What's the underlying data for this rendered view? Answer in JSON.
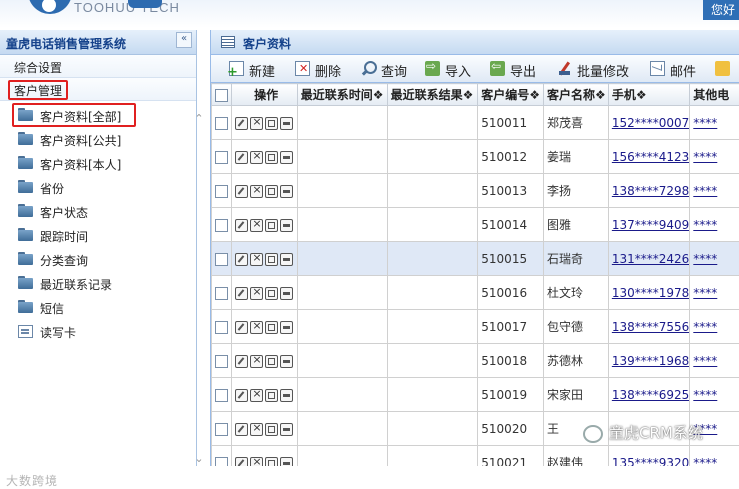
{
  "banner": {
    "brand": "TOOHUU TECH",
    "greeting": "您好"
  },
  "sidebar": {
    "title": "童虎电话销售管理系统",
    "collapse_glyph": "«",
    "sections": [
      {
        "label": "综合设置"
      },
      {
        "label": "客户管理"
      }
    ],
    "items": [
      {
        "label": "客户资料[全部]",
        "icon": "folder-icon"
      },
      {
        "label": "客户资料[公共]",
        "icon": "folder-icon"
      },
      {
        "label": "客户资料[本人]",
        "icon": "folder-icon"
      },
      {
        "label": "省份",
        "icon": "folder-icon"
      },
      {
        "label": "客户状态",
        "icon": "folder-icon"
      },
      {
        "label": "跟踪时间",
        "icon": "folder-icon"
      },
      {
        "label": "分类查询",
        "icon": "folder-icon"
      },
      {
        "label": "最近联系记录",
        "icon": "folder-icon"
      },
      {
        "label": "短信",
        "icon": "folder-icon"
      },
      {
        "label": "读写卡",
        "icon": "card-icon"
      }
    ],
    "watermark": "大数跨境"
  },
  "main": {
    "title": "客户资料",
    "toolbar": {
      "new": "新建",
      "delete": "删除",
      "search": "查询",
      "import": "导入",
      "export": "导出",
      "batch_edit": "批量修改",
      "mail": "邮件"
    },
    "columns": {
      "ops": "操作",
      "last_time": "最近联系时间❖",
      "last_result": "最近联系结果❖",
      "code": "客户编号❖",
      "name": "客户名称❖",
      "phone": "手机❖",
      "other": "其他电"
    },
    "rows": [
      {
        "code": "510011",
        "name": "郑茂喜",
        "phone": "152****0007",
        "other": "****"
      },
      {
        "code": "510012",
        "name": "姜瑞",
        "phone": "156****4123",
        "other": "****"
      },
      {
        "code": "510013",
        "name": "李扬",
        "phone": "138****7298",
        "other": "****"
      },
      {
        "code": "510014",
        "name": "图雅",
        "phone": "137****9409",
        "other": "****"
      },
      {
        "code": "510015",
        "name": "石瑞奇",
        "phone": "131****2426",
        "other": "****"
      },
      {
        "code": "510016",
        "name": "杜文玲",
        "phone": "130****1978",
        "other": "****"
      },
      {
        "code": "510017",
        "name": "包守德",
        "phone": "138****7556",
        "other": "****"
      },
      {
        "code": "510018",
        "name": "苏德林",
        "phone": "139****1968",
        "other": "****"
      },
      {
        "code": "510019",
        "name": "宋家田",
        "phone": "138****6925",
        "other": "****"
      },
      {
        "code": "510020",
        "name": "王",
        "phone": "",
        "other": "****"
      },
      {
        "code": "510021",
        "name": "赵建伟",
        "phone": "135****9320",
        "other": "****"
      }
    ],
    "watermark": "童虎CRM系统"
  },
  "colors": {
    "header_blue": "#15428b",
    "highlight_red": "#e02020",
    "selected_row": "#dfe8f6"
  }
}
